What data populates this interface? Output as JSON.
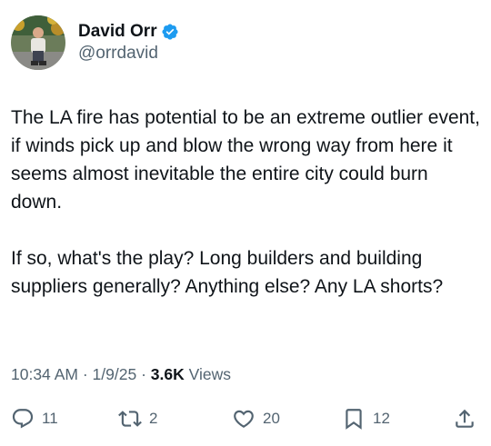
{
  "author": {
    "name": "David Orr",
    "handle": "@orrdavid",
    "verified": true,
    "verified_color": "#1d9bf0"
  },
  "tweet": {
    "paragraphs": [
      "The LA fire has potential to be an extreme outlier event, if winds pick up and blow the wrong way from here it seems almost inevitable the entire city could burn down.",
      "If so, what's the play?  Long builders and building suppliers generally?  Anything else?  Any LA shorts?"
    ]
  },
  "meta": {
    "time": "10:34 AM",
    "separator": "·",
    "date": "1/9/25",
    "views_count": "3.6K",
    "views_label": "Views"
  },
  "actions": {
    "reply": {
      "icon": "reply-icon",
      "count": "11"
    },
    "repost": {
      "icon": "repost-icon",
      "count": "2"
    },
    "like": {
      "icon": "heart-icon",
      "count": "20"
    },
    "bookmark": {
      "icon": "bookmark-icon",
      "count": "12"
    },
    "share": {
      "icon": "share-icon"
    }
  },
  "colors": {
    "text_primary": "#0f1419",
    "text_secondary": "#536471",
    "accent": "#1d9bf0"
  }
}
